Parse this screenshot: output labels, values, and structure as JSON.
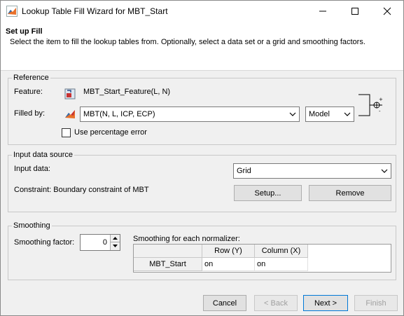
{
  "window": {
    "title": "Lookup Table Fill Wizard for MBT_Start",
    "minimize_icon": "minimize-icon",
    "maximize_icon": "maximize-icon",
    "close_icon": "close-icon"
  },
  "header": {
    "title": "Set up Fill",
    "description": "Select the item to fill the lookup tables from. Optionally, select a data set or a grid and smoothing factors."
  },
  "reference": {
    "group_label": "Reference",
    "feature_label": "Feature:",
    "feature_value": "MBT_Start_Feature(L, N)",
    "filled_by_label": "Filled by:",
    "filled_by_value": "MBT(N, L, ICP, ECP)",
    "type_value": "Model",
    "use_percentage_error_label": "Use percentage error",
    "use_percentage_error_checked": false
  },
  "input_data_source": {
    "group_label": "Input data source",
    "input_data_label": "Input data:",
    "input_data_value": "Grid",
    "constraint_text": "Constraint: Boundary constraint of MBT",
    "setup_button": "Setup...",
    "remove_button": "Remove"
  },
  "smoothing": {
    "group_label": "Smoothing",
    "factor_label": "Smoothing factor:",
    "factor_value": "0",
    "normalizer_label": "Smoothing for each normalizer:",
    "table": {
      "columns": [
        "Row (Y)",
        "Column (X)"
      ],
      "rows": [
        {
          "name": "MBT_Start",
          "values": [
            "on",
            "on"
          ]
        }
      ]
    }
  },
  "footer": {
    "cancel": "Cancel",
    "back": "< Back",
    "next": "Next >",
    "finish": "Finish"
  }
}
